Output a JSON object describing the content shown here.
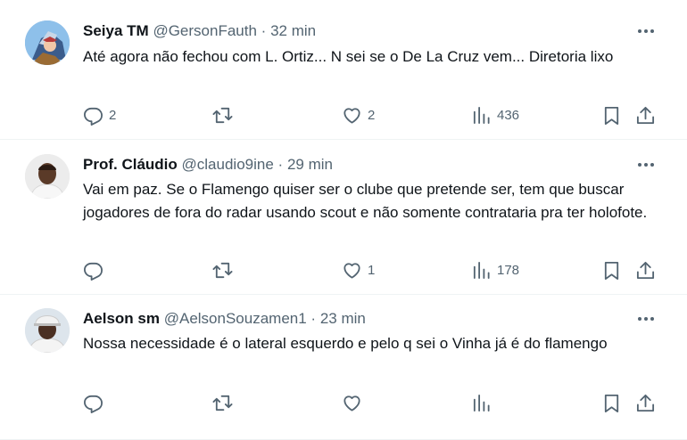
{
  "tweets": [
    {
      "name": "Seiya TM",
      "handle": "@GersonFauth",
      "dot": "·",
      "time": "32 min",
      "text": "Até agora não fechou com L. Ortiz... N sei se o De La Cruz vem... Diretoria lixo",
      "replies": "2",
      "retweets": "",
      "likes": "2",
      "views": "436",
      "avatar_bg": "#7fb1e0"
    },
    {
      "name": "Prof. Cláudio",
      "handle": "@claudio9ine",
      "dot": "·",
      "time": "29 min",
      "text": "Vai em paz. Se o Flamengo quiser ser o clube que pretende ser, tem que buscar jogadores de fora do radar usando scout e não somente contrataria pra ter holofote.",
      "replies": "",
      "retweets": "",
      "likes": "1",
      "views": "178",
      "avatar_bg": "#e9e9e9"
    },
    {
      "name": "Aelson sm",
      "handle": "@AelsonSouzamen1",
      "dot": "·",
      "time": "23 min",
      "text": "Nossa necessidade é o lateral esquerdo e pelo q sei o Vinha já é do flamengo",
      "replies": "",
      "retweets": "",
      "likes": "",
      "views": "",
      "avatar_bg": "#d9e2ea"
    }
  ],
  "colors": {
    "text": "#0f1419",
    "muted": "#536471",
    "border": "#eff3f4"
  },
  "icons": [
    "reply-icon",
    "retweet-icon",
    "like-icon",
    "views-icon",
    "bookmark-icon",
    "share-icon",
    "more-icon"
  ]
}
